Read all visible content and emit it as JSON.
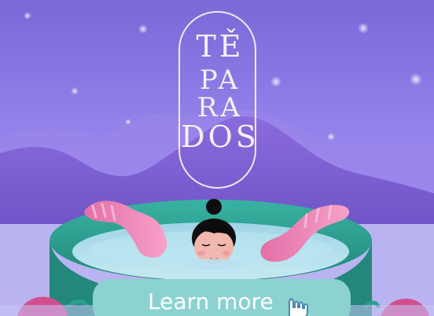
{
  "logo": {
    "line1": "TĚ",
    "line2": "PA",
    "line3": "RA",
    "line4": "DOS"
  },
  "cta": {
    "label": "Learn more"
  },
  "icons": {
    "cursor": "pointer-hand-icon"
  },
  "colors": {
    "sky_top": "#7b68d8",
    "sky_bottom": "#9f92ec",
    "mountains": "#8a6bdc",
    "tub_rim": "#2f9a8c",
    "water": "#a9d8e7",
    "tentacles": "#f08fb7",
    "cta_bg": "#8bd2d1",
    "text_white": "#ffffff"
  }
}
